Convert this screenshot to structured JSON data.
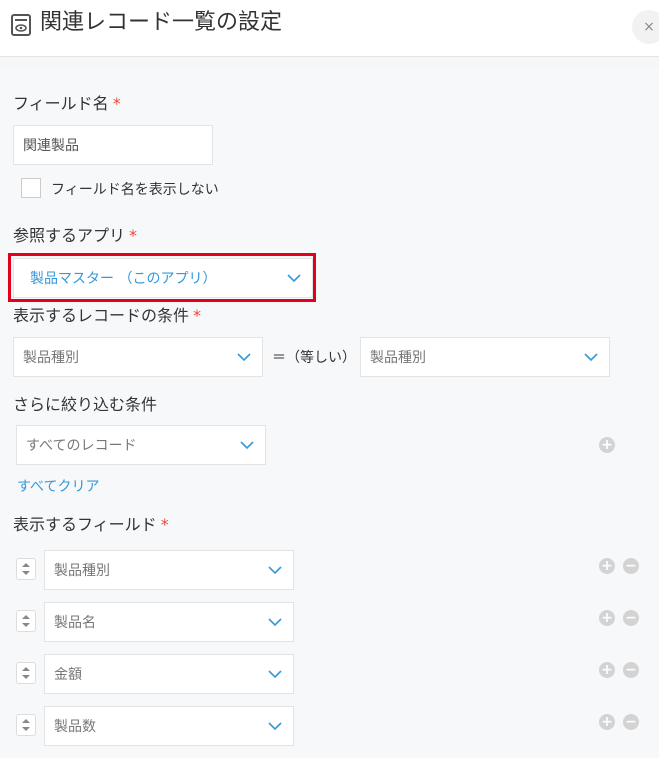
{
  "header": {
    "title": "関連レコード一覧の設定",
    "close_label": "×"
  },
  "field_name": {
    "label": "フィールド名",
    "required_mark": "*",
    "value": "関連製品",
    "hide_label": "フィールド名を表示しない",
    "hide_checked": false
  },
  "reference_app": {
    "label": "参照するアプリ",
    "required_mark": "*",
    "selected": "製品マスター （このアプリ）"
  },
  "display_condition": {
    "label": "表示するレコードの条件",
    "required_mark": "*",
    "left_field": "製品種別",
    "operator": "＝（等しい）",
    "right_field": "製品種別"
  },
  "filter": {
    "label": "さらに絞り込む条件",
    "selected": "すべてのレコード",
    "clear_label": "すべてクリア"
  },
  "display_fields": {
    "label": "表示するフィールド",
    "required_mark": "*",
    "items": [
      {
        "value": "製品種別"
      },
      {
        "value": "製品名"
      },
      {
        "value": "金額"
      },
      {
        "value": "製品数"
      }
    ]
  },
  "icons": {
    "plus": "+",
    "minus": "−"
  }
}
